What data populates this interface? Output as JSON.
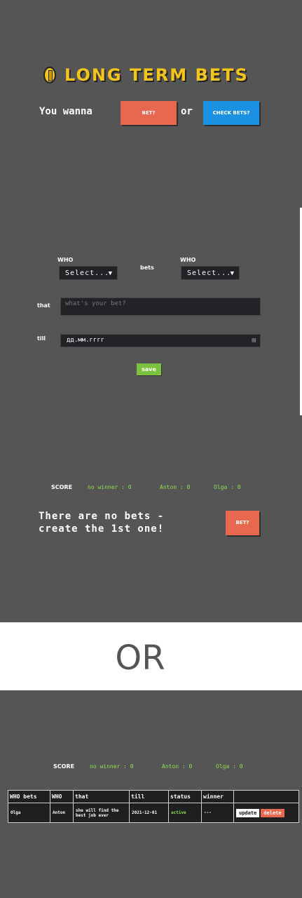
{
  "app": {
    "title": "LONG TERM BETS"
  },
  "intro": {
    "prefix": "You wanna",
    "bet_button": "BET?",
    "or": "or",
    "check_button": "CHECK BETS?"
  },
  "form": {
    "who_label_1": "WHO",
    "who_value_1": "Select...",
    "bets_label": "bets",
    "who_label_2": "WHO",
    "who_value_2": "Select...",
    "that_label": "that",
    "that_placeholder": "what's your bet?",
    "till_label": "till",
    "till_value": "дд.мм.гггг",
    "save_button": "save"
  },
  "score": {
    "label": "SCORE",
    "no_winner": "no winner : 0",
    "anton": "Anton : 0",
    "olga": "Olga : 0"
  },
  "empty_state": {
    "line1": "There are no bets -",
    "line2": "create the 1st one!",
    "bet_button": "BET?"
  },
  "divider": "OR",
  "score2": {
    "label": "SCORE",
    "no_winner": "no winner : 0",
    "anton": "Anton : 0",
    "olga": "Olga : 0"
  },
  "table": {
    "headers": [
      "WHO bets",
      "WHO",
      "that",
      "till",
      "status",
      "winner",
      ""
    ],
    "rows": [
      {
        "who_bets": "Olga",
        "who": "Anton",
        "that": "she will find the best job ever",
        "till": "2021-12-01",
        "status": "active",
        "winner": "---",
        "update": "update",
        "delete": "delete"
      }
    ]
  },
  "colors": {
    "panel": "#555555",
    "accent_yellow": "#f3c419",
    "btn_red": "#e8674f",
    "btn_blue": "#1b91e4",
    "green": "#8ee04d"
  },
  "icons": {
    "logo": "coin-icon",
    "dropdown": "triangle-down-icon",
    "date": "calendar-icon"
  }
}
